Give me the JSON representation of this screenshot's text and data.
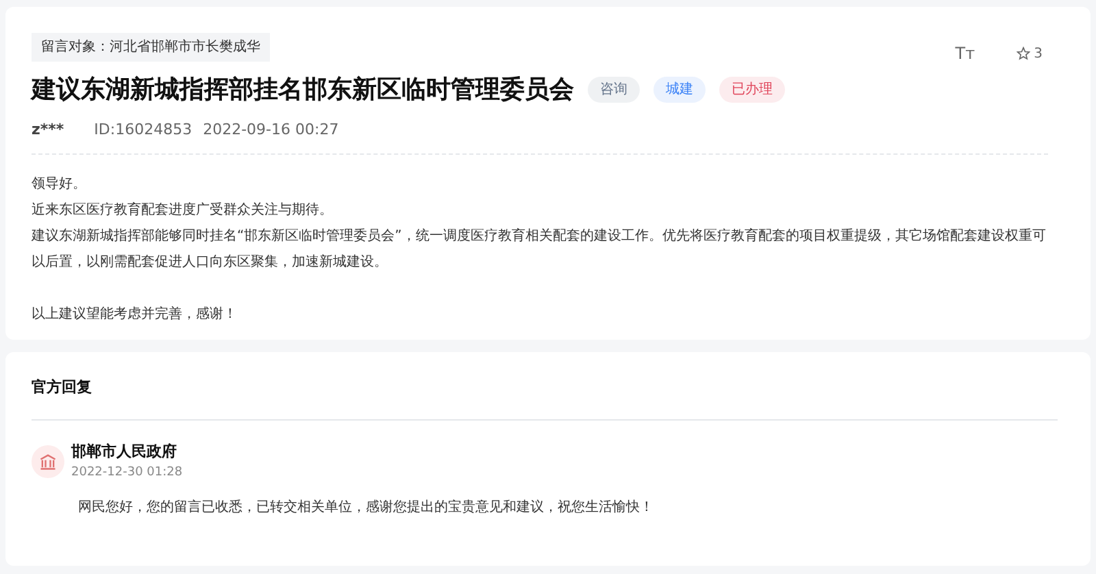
{
  "message": {
    "recipient": "留言对象：河北省邯郸市市长樊成华",
    "title": "建议东湖新城指挥部挂名邯东新区临时管理委员会",
    "tags": [
      {
        "label": "咨询",
        "color": "#64748b"
      },
      {
        "label": "城建",
        "color": "#3b82f6"
      },
      {
        "label": "已办理",
        "color": "#e0445a"
      }
    ],
    "font_size_label": "Tт",
    "star_count": "3",
    "author": "z***",
    "id": "ID:16024853",
    "time": "2022-09-16 00:27",
    "paragraphs": [
      "领导好。",
      "近来东区医疗教育配套进度广受群众关注与期待。",
      "建议东湖新城指挥部能够同时挂名“邯东新区临时管理委员会”，统一调度医疗教育相关配套的建设工作。优先将医疗教育配套的项目权重提级，其它场馆配套建设权重可以后置，以刚需配套促进人口向东区聚集，加速新城建设。"
    ],
    "closing": "以上建议望能考虑并完善，感谢！"
  },
  "reply": {
    "heading": "官方回复",
    "org": "邯郸市人民政府",
    "time": "2022-12-30 01:28",
    "text": "网民您好，您的留言已收悉，已转交相关单位，感谢您提出的宝贵意见和建议，祝您生活愉快！"
  }
}
